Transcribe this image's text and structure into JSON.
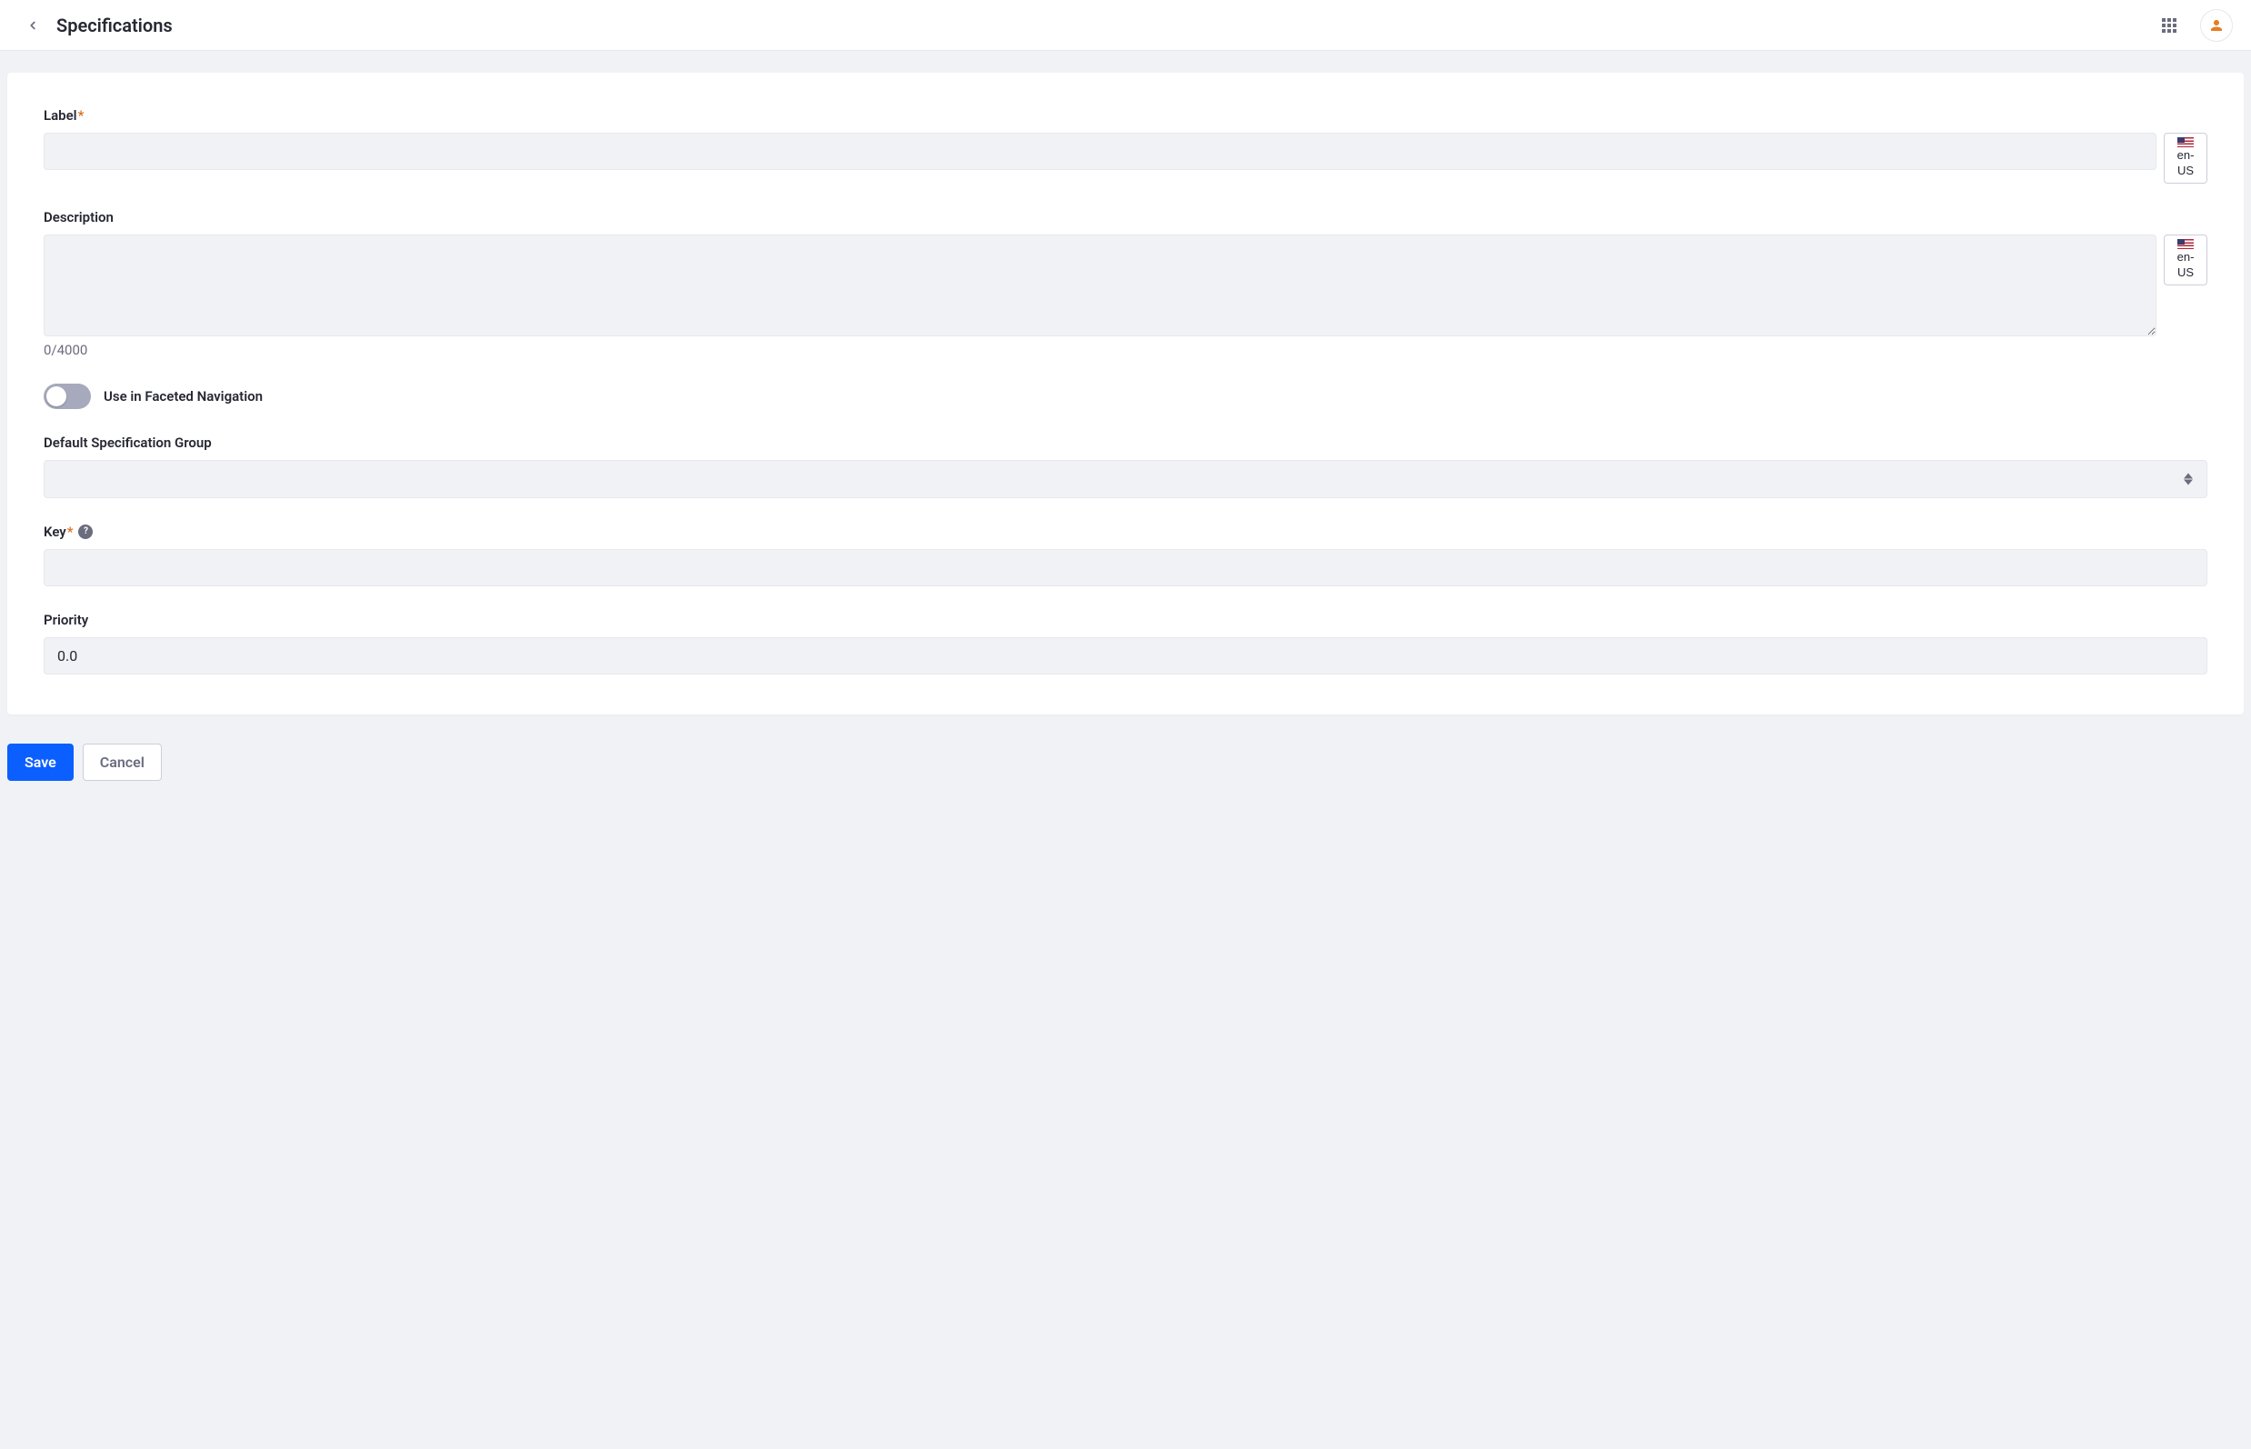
{
  "header": {
    "title": "Specifications"
  },
  "locale": {
    "code": "en-US"
  },
  "form": {
    "label": {
      "text": "Label",
      "value": ""
    },
    "description": {
      "text": "Description",
      "value": "",
      "charCount": "0/4000"
    },
    "facetedNav": {
      "text": "Use in Faceted Navigation",
      "value": false
    },
    "specGroup": {
      "text": "Default Specification Group",
      "value": ""
    },
    "key": {
      "text": "Key",
      "value": ""
    },
    "priority": {
      "text": "Priority",
      "value": "0.0"
    }
  },
  "buttons": {
    "save": "Save",
    "cancel": "Cancel"
  }
}
